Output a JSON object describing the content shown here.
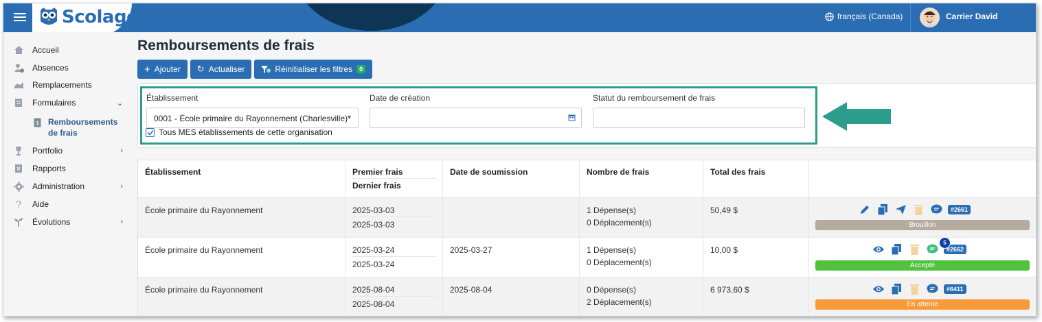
{
  "app": {
    "logo_text": "Scolago",
    "language": "français (Canada)",
    "user_name": "Carrier David"
  },
  "sidebar": {
    "items": [
      {
        "label": "Accueil",
        "icon": "home-icon"
      },
      {
        "label": "Absences",
        "icon": "absence-icon"
      },
      {
        "label": "Remplacements",
        "icon": "replacement-icon"
      },
      {
        "label": "Formulaires",
        "icon": "form-icon"
      },
      {
        "label": "Remboursements de frais",
        "icon": "expense-icon"
      },
      {
        "label": "Portfolio",
        "icon": "trophy-icon"
      },
      {
        "label": "Rapports",
        "icon": "report-icon"
      },
      {
        "label": "Administration",
        "icon": "gear-icon"
      },
      {
        "label": "Aide",
        "icon": "help-icon"
      },
      {
        "label": "Évolutions",
        "icon": "sprout-icon"
      }
    ]
  },
  "page": {
    "title": "Remboursements de frais"
  },
  "toolbar": {
    "add_label": "Ajouter",
    "refresh_label": "Actualiser",
    "reset_label": "Réinitialiser les filtres",
    "reset_count": "0"
  },
  "filters": {
    "establishment_label": "Établissement",
    "establishment_value": "0001 - École primaire du Rayonnement (Charlesville)",
    "creation_date_label": "Date de création",
    "creation_date_value": "",
    "status_label": "Statut du remboursement de frais",
    "status_value": "",
    "all_checkbox_label": "Tous MES établissements de cette organisation",
    "all_checkbox_checked": true
  },
  "table": {
    "headers": {
      "establishment": "Établissement",
      "first_fee": "Premier frais",
      "last_fee": "Dernier frais",
      "submission_date": "Date de soumission",
      "fee_count": "Nombre de frais",
      "fee_total": "Total des frais"
    },
    "rows": [
      {
        "establishment": "École primaire du Rayonnement",
        "first_fee": "2025-03-03",
        "last_fee": "2025-03-03",
        "submission_date": "",
        "expenses": "1 Dépense(s)",
        "trips": "0 Déplacement(s)",
        "total": "50,49 $",
        "id": "#2661",
        "status": "Brouillon",
        "status_color": "#b6ab9f",
        "actions": [
          "edit-icon",
          "copy-icon",
          "send-icon",
          "trash-icon",
          "comment-icon"
        ]
      },
      {
        "establishment": "École primaire du Rayonnement",
        "first_fee": "2025-03-24",
        "last_fee": "2025-03-24",
        "submission_date": "2025-03-27",
        "expenses": "1 Dépense(s)",
        "trips": "0 Déplacement(s)",
        "total": "10,00 $",
        "id": "#2662",
        "status": "Accepté",
        "status_color": "#52c23e",
        "comment_count": "5",
        "actions": [
          "view-icon",
          "copy-icon",
          "trash-icon",
          "comment-icon"
        ]
      },
      {
        "establishment": "École primaire du Rayonnement",
        "first_fee": "2025-08-04",
        "last_fee": "2025-08-04",
        "submission_date": "2025-08-04",
        "expenses": "0 Dépense(s)",
        "trips": "2 Déplacement(s)",
        "total": "6 973,60 $",
        "id": "#6411",
        "status": "En attente",
        "status_color": "#f89a3a",
        "actions": [
          "view-icon",
          "copy-icon",
          "trash-icon",
          "comment-icon"
        ]
      }
    ]
  },
  "colors": {
    "primary": "#2b6db3",
    "highlight": "#2c9c8c"
  }
}
